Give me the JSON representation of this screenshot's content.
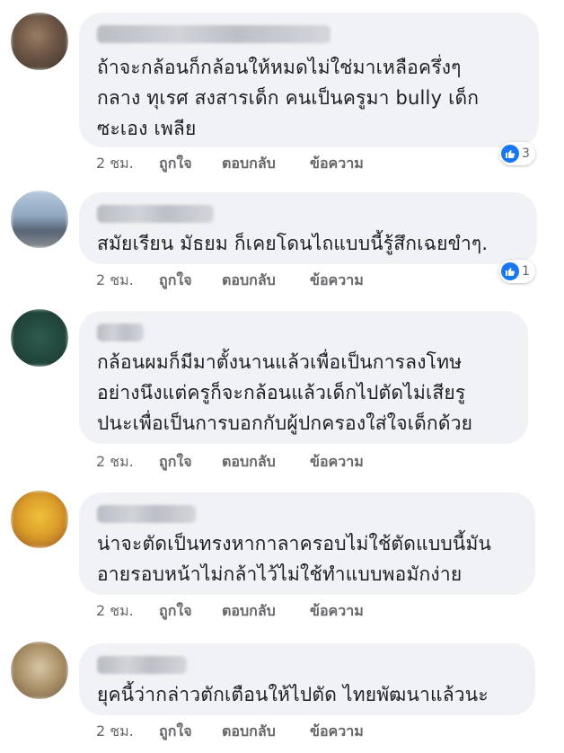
{
  "labels": {
    "time": "2 ชม.",
    "like": "ถูกใจ",
    "reply": "ตอบกลับ",
    "message": "ข้อความ"
  },
  "comments": [
    {
      "text": "ถ้าจะกล้อนก็กล้อนให้หมดไม่ใช่มาเหลือครึ่งๆ\nกลาง ทุเรศ สงสารเด็ก คนเป็นครูมา bully เด็ก\nซะเอง เพลีย",
      "reactions": "3"
    },
    {
      "text": "สมัยเรียน มัธยม ก็เคยโดนไถแบบนี้รู้สึกเฉยขำๆ.",
      "reactions": "1"
    },
    {
      "text": "กล้อนผมก็มีมาตั้งนานแล้วเพื่อเป็นการลงโทษ\nอย่างนึงแต่ครูก็จะกล้อนแล้วเด็กไปตัดไม่เสียรู\nปนะเพื่อเป็นการบอกกับผู้ปกครองใส่ใจเด็กด้วย"
    },
    {
      "text": "น่าจะตัดเป็นทรงหากาลาครอบไม่ใช้ตัดแบบนี้มัน\nอายรอบหน้าไม่กล้าไว้ไม่ใช้ทำแบบพอมักง่าย"
    },
    {
      "text": "ยุคนี้ว่ากล่าวตักเตือนให้ไปตัด ไทยพัฒนาแล้วนะ"
    }
  ],
  "colors": {
    "bubble": "#f0f2f5",
    "text": "#1c1e21",
    "meta": "#65676b",
    "like_blue": "#1877f2"
  }
}
